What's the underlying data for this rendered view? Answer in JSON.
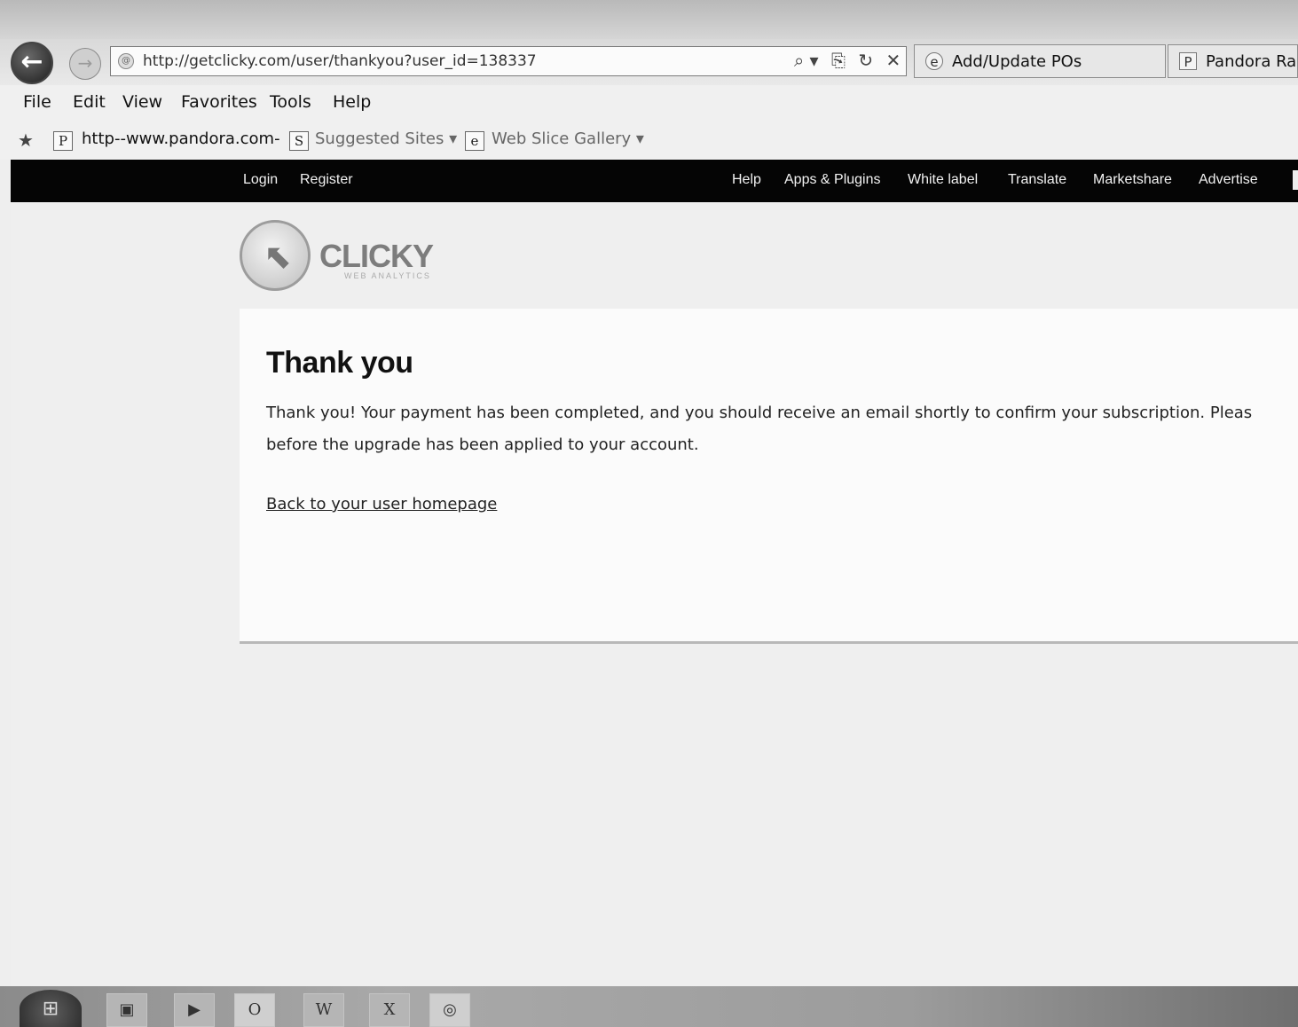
{
  "browser": {
    "url": "http://getclicky.com/user/thankyou?user_id=138337",
    "url_tools": [
      "⌕ ▾",
      "⎘",
      "↻",
      "✕"
    ],
    "tabs": [
      {
        "label": "Add/Update POs",
        "icon": "e"
      },
      {
        "label": "Pandora Ra",
        "icon": "P"
      }
    ],
    "back_glyph": "←",
    "forward_glyph": "→",
    "url_icon": "@"
  },
  "menubar": {
    "items": [
      "File",
      "Edit",
      "View",
      "Favorites",
      "Tools",
      "Help"
    ]
  },
  "favorites": {
    "star_glyph": "★",
    "items": [
      {
        "label": "http--www.pandora.com-",
        "icon": "P"
      },
      {
        "label": "Suggested Sites ▾",
        "icon": "S"
      },
      {
        "label": "Web Slice Gallery ▾",
        "icon": "e"
      }
    ]
  },
  "sitenav": {
    "left": [
      "Login",
      "Register"
    ],
    "right": [
      "Help",
      "Apps & Plugins",
      "White label",
      "Translate",
      "Marketshare",
      "Advertise"
    ]
  },
  "logo": {
    "name": "CLICKY",
    "sub": "WEB ANALYTICS",
    "arrow": "⬉"
  },
  "content": {
    "title": "Thank you",
    "body_line1": "Thank you! Your payment has been completed, and you should receive an email shortly to confirm your subscription. Pleas",
    "body_line2": "before the upgrade has been applied to your account.",
    "link": "Back to your user homepage"
  },
  "taskbar": {
    "start_glyph": "⊞",
    "buttons": [
      "▣",
      "▶",
      "O",
      "W",
      "X",
      "◎"
    ]
  }
}
